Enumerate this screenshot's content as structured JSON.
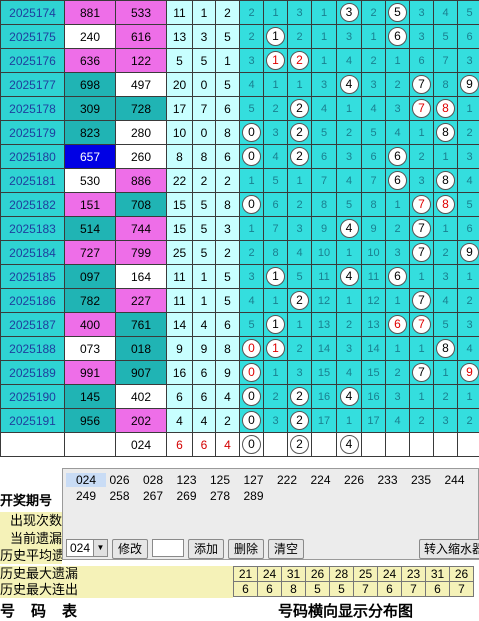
{
  "rows": [
    {
      "period": "2025174",
      "a": "881",
      "ac": "pink",
      "b": "533",
      "bc": "pink",
      "c1": "11",
      "c2": "1",
      "c3": "2",
      "dist": [
        [
          "2",
          ""
        ],
        [
          "1",
          ""
        ],
        [
          "3",
          ""
        ],
        [
          "1",
          ""
        ],
        [
          "3",
          "b"
        ],
        [
          "2",
          ""
        ],
        [
          "5",
          "b"
        ],
        [
          "3",
          ""
        ],
        [
          "4",
          ""
        ],
        [
          "5",
          ""
        ],
        [
          "1",
          ""
        ]
      ]
    },
    {
      "period": "2025175",
      "a": "240",
      "ac": "white",
      "b": "616",
      "bc": "pink",
      "c1": "13",
      "c2": "3",
      "c3": "5",
      "dist": [
        [
          "2",
          ""
        ],
        [
          "1",
          "b"
        ],
        [
          "2",
          ""
        ],
        [
          "1",
          ""
        ],
        [
          "3",
          ""
        ],
        [
          "1",
          ""
        ],
        [
          "6",
          "b"
        ],
        [
          "3",
          ""
        ],
        [
          "5",
          ""
        ],
        [
          "6",
          ""
        ],
        [
          "2",
          ""
        ]
      ]
    },
    {
      "period": "2025176",
      "a": "636",
      "ac": "pink",
      "b": "122",
      "bc": "pink",
      "c1": "5",
      "c2": "5",
      "c3": "1",
      "dist": [
        [
          "3",
          ""
        ],
        [
          "1",
          "r"
        ],
        [
          "2",
          "r"
        ],
        [
          "1",
          ""
        ],
        [
          "4",
          ""
        ],
        [
          "2",
          ""
        ],
        [
          "1",
          ""
        ],
        [
          "6",
          ""
        ],
        [
          "7",
          ""
        ],
        [
          "3",
          ""
        ],
        [
          "3",
          ""
        ]
      ]
    },
    {
      "period": "2025177",
      "a": "698",
      "ac": "teal",
      "b": "497",
      "bc": "white",
      "c1": "20",
      "c2": "0",
      "c3": "5",
      "dist": [
        [
          "4",
          ""
        ],
        [
          "1",
          ""
        ],
        [
          "1",
          ""
        ],
        [
          "3",
          ""
        ],
        [
          "4",
          "b"
        ],
        [
          "3",
          ""
        ],
        [
          "2",
          ""
        ],
        [
          "7",
          "b"
        ],
        [
          "8",
          ""
        ],
        [
          "9",
          "b"
        ],
        [
          "4",
          ""
        ]
      ]
    },
    {
      "period": "2025178",
      "a": "309",
      "ac": "teal",
      "b": "728",
      "bc": "teal",
      "c1": "17",
      "c2": "7",
      "c3": "6",
      "dist": [
        [
          "5",
          ""
        ],
        [
          "2",
          ""
        ],
        [
          "2",
          "b"
        ],
        [
          "4",
          ""
        ],
        [
          "1",
          ""
        ],
        [
          "4",
          ""
        ],
        [
          "3",
          ""
        ],
        [
          "7",
          "r"
        ],
        [
          "8",
          "r"
        ],
        [
          "1",
          ""
        ],
        [
          "5",
          ""
        ]
      ]
    },
    {
      "period": "2025179",
      "a": "823",
      "ac": "teal",
      "b": "280",
      "bc": "white",
      "c1": "10",
      "c2": "0",
      "c3": "8",
      "dist": [
        [
          "0",
          "b"
        ],
        [
          "3",
          ""
        ],
        [
          "2",
          "b"
        ],
        [
          "5",
          ""
        ],
        [
          "2",
          ""
        ],
        [
          "5",
          ""
        ],
        [
          "4",
          ""
        ],
        [
          "1",
          ""
        ],
        [
          "8",
          "b"
        ],
        [
          "2",
          ""
        ],
        [
          "6",
          ""
        ]
      ]
    },
    {
      "period": "2025180",
      "a": "657",
      "ac": "blue",
      "b": "260",
      "bc": "white",
      "c1": "8",
      "c2": "8",
      "c3": "6",
      "dist": [
        [
          "0",
          "b"
        ],
        [
          "4",
          ""
        ],
        [
          "2",
          "b"
        ],
        [
          "6",
          ""
        ],
        [
          "3",
          ""
        ],
        [
          "6",
          ""
        ],
        [
          "6",
          "b"
        ],
        [
          "2",
          ""
        ],
        [
          "1",
          ""
        ],
        [
          "3",
          ""
        ],
        [
          "7",
          ""
        ]
      ]
    },
    {
      "period": "2025181",
      "a": "530",
      "ac": "white",
      "b": "886",
      "bc": "pink",
      "c1": "22",
      "c2": "2",
      "c3": "2",
      "dist": [
        [
          "1",
          ""
        ],
        [
          "5",
          ""
        ],
        [
          "1",
          ""
        ],
        [
          "7",
          ""
        ],
        [
          "4",
          ""
        ],
        [
          "7",
          ""
        ],
        [
          "6",
          "b"
        ],
        [
          "3",
          ""
        ],
        [
          "8",
          "b"
        ],
        [
          "4",
          ""
        ],
        [
          "8",
          ""
        ]
      ]
    },
    {
      "period": "2025182",
      "a": "151",
      "ac": "pink",
      "b": "708",
      "bc": "teal",
      "c1": "15",
      "c2": "5",
      "c3": "8",
      "dist": [
        [
          "0",
          "b"
        ],
        [
          "6",
          ""
        ],
        [
          "2",
          ""
        ],
        [
          "8",
          ""
        ],
        [
          "5",
          ""
        ],
        [
          "8",
          ""
        ],
        [
          "1",
          ""
        ],
        [
          "7",
          "r"
        ],
        [
          "8",
          "r"
        ],
        [
          "5",
          ""
        ],
        [
          "9",
          ""
        ]
      ]
    },
    {
      "period": "2025183",
      "a": "514",
      "ac": "teal",
      "b": "744",
      "bc": "pink",
      "c1": "15",
      "c2": "5",
      "c3": "3",
      "dist": [
        [
          "1",
          ""
        ],
        [
          "7",
          ""
        ],
        [
          "3",
          ""
        ],
        [
          "9",
          ""
        ],
        [
          "4",
          "b"
        ],
        [
          "9",
          ""
        ],
        [
          "2",
          ""
        ],
        [
          "7",
          "b"
        ],
        [
          "1",
          ""
        ],
        [
          "6",
          ""
        ],
        [
          "10",
          ""
        ]
      ]
    },
    {
      "period": "2025184",
      "a": "727",
      "ac": "pink",
      "b": "799",
      "bc": "pink",
      "c1": "25",
      "c2": "5",
      "c3": "2",
      "dist": [
        [
          "2",
          ""
        ],
        [
          "8",
          ""
        ],
        [
          "4",
          ""
        ],
        [
          "10",
          ""
        ],
        [
          "1",
          ""
        ],
        [
          "10",
          ""
        ],
        [
          "3",
          ""
        ],
        [
          "7",
          "b"
        ],
        [
          "2",
          ""
        ],
        [
          "9",
          "b"
        ],
        [
          "11",
          ""
        ]
      ]
    },
    {
      "period": "2025185",
      "a": "097",
      "ac": "teal",
      "b": "164",
      "bc": "white",
      "c1": "11",
      "c2": "1",
      "c3": "5",
      "dist": [
        [
          "3",
          ""
        ],
        [
          "1",
          "b"
        ],
        [
          "5",
          ""
        ],
        [
          "11",
          ""
        ],
        [
          "4",
          "b"
        ],
        [
          "11",
          ""
        ],
        [
          "6",
          "b"
        ],
        [
          "1",
          ""
        ],
        [
          "3",
          ""
        ],
        [
          "1",
          ""
        ],
        [
          "12",
          ""
        ]
      ]
    },
    {
      "period": "2025186",
      "a": "782",
      "ac": "teal",
      "b": "227",
      "bc": "pink",
      "c1": "11",
      "c2": "1",
      "c3": "5",
      "dist": [
        [
          "4",
          ""
        ],
        [
          "1",
          ""
        ],
        [
          "2",
          "b"
        ],
        [
          "12",
          ""
        ],
        [
          "1",
          ""
        ],
        [
          "12",
          ""
        ],
        [
          "1",
          ""
        ],
        [
          "7",
          "b"
        ],
        [
          "4",
          ""
        ],
        [
          "2",
          ""
        ],
        [
          "13",
          ""
        ]
      ]
    },
    {
      "period": "2025187",
      "a": "400",
      "ac": "pink",
      "b": "761",
      "bc": "teal",
      "c1": "14",
      "c2": "4",
      "c3": "6",
      "dist": [
        [
          "5",
          ""
        ],
        [
          "1",
          "b"
        ],
        [
          "1",
          ""
        ],
        [
          "13",
          ""
        ],
        [
          "2",
          ""
        ],
        [
          "13",
          ""
        ],
        [
          "6",
          "r"
        ],
        [
          "7",
          "r"
        ],
        [
          "5",
          ""
        ],
        [
          "3",
          ""
        ],
        [
          "14",
          ""
        ]
      ]
    },
    {
      "period": "2025188",
      "a": "073",
      "ac": "white",
      "b": "018",
      "bc": "teal",
      "c1": "9",
      "c2": "9",
      "c3": "8",
      "dist": [
        [
          "0",
          "r"
        ],
        [
          "1",
          "r"
        ],
        [
          "2",
          ""
        ],
        [
          "14",
          ""
        ],
        [
          "3",
          ""
        ],
        [
          "14",
          ""
        ],
        [
          "1",
          ""
        ],
        [
          "1",
          ""
        ],
        [
          "8",
          "b"
        ],
        [
          "4",
          ""
        ],
        [
          "0",
          "r"
        ]
      ]
    },
    {
      "period": "2025189",
      "a": "991",
      "ac": "pink",
      "b": "907",
      "bc": "teal",
      "c1": "16",
      "c2": "6",
      "c3": "9",
      "dist": [
        [
          "0",
          "r"
        ],
        [
          "1",
          ""
        ],
        [
          "3",
          ""
        ],
        [
          "15",
          ""
        ],
        [
          "4",
          ""
        ],
        [
          "15",
          ""
        ],
        [
          "2",
          ""
        ],
        [
          "7",
          "b"
        ],
        [
          "1",
          ""
        ],
        [
          "9",
          "r"
        ],
        [
          "1",
          ""
        ]
      ]
    },
    {
      "period": "2025190",
      "a": "145",
      "ac": "teal",
      "b": "402",
      "bc": "white",
      "c1": "6",
      "c2": "6",
      "c3": "4",
      "dist": [
        [
          "0",
          "b"
        ],
        [
          "2",
          ""
        ],
        [
          "2",
          "b"
        ],
        [
          "16",
          ""
        ],
        [
          "4",
          "b"
        ],
        [
          "16",
          ""
        ],
        [
          "3",
          ""
        ],
        [
          "1",
          ""
        ],
        [
          "2",
          ""
        ],
        [
          "1",
          ""
        ],
        [
          "2",
          ""
        ]
      ]
    },
    {
      "period": "2025191",
      "a": "956",
      "ac": "teal",
      "b": "202",
      "bc": "pink",
      "c1": "4",
      "c2": "4",
      "c3": "2",
      "dist": [
        [
          "0",
          "b"
        ],
        [
          "3",
          ""
        ],
        [
          "2",
          "b"
        ],
        [
          "17",
          ""
        ],
        [
          "1",
          ""
        ],
        [
          "17",
          ""
        ],
        [
          "4",
          ""
        ],
        [
          "2",
          ""
        ],
        [
          "3",
          ""
        ],
        [
          "2",
          ""
        ],
        [
          "3",
          ""
        ]
      ]
    }
  ],
  "sum_row": {
    "b": "024",
    "c1": "6",
    "c2": "6",
    "c3": "4",
    "balls": [
      "0",
      "",
      "2",
      "",
      "4",
      "",
      "",
      "",
      "",
      "",
      ""
    ]
  },
  "chips_row1": [
    "024",
    "026",
    "028",
    "123",
    "125",
    "127",
    "222",
    "224",
    "226",
    "233",
    "235",
    "244"
  ],
  "chips_row2": [
    "249",
    "258",
    "267",
    "269",
    "278",
    "289"
  ],
  "combo_value": "024",
  "buttons": {
    "modify": "修改",
    "add": "添加",
    "delete": "删除",
    "clear": "清空",
    "import": "转入缩水器"
  },
  "labels": {
    "period_header": "开奖期号",
    "count": "出现次数",
    "current_miss": "当前遗漏",
    "hist_avg": "历史平均遗漏",
    "hist_max_miss": "历史最大遗漏",
    "hist_max_streak": "历史最大连出"
  },
  "max_miss": [
    "21",
    "24",
    "31",
    "26",
    "28",
    "25",
    "24",
    "23",
    "31",
    "26"
  ],
  "max_streak": [
    "6",
    "6",
    "8",
    "5",
    "5",
    "7",
    "6",
    "7",
    "6",
    "7"
  ],
  "footer": {
    "left": "号码表",
    "right": "号码横向显示分布图"
  },
  "colors": {
    "period_bg": "#2fd3d3",
    "pink": "#ee6ee8",
    "teal": "#20b4b4",
    "dist_bg": "#34dede"
  }
}
